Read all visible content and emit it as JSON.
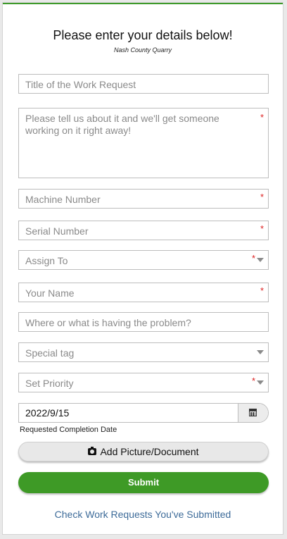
{
  "header": {
    "title": "Please enter your details below!",
    "subtitle": "Nash County Quarry"
  },
  "form": {
    "title_field": {
      "placeholder": "Title of the Work Request",
      "required": false
    },
    "description_field": {
      "placeholder": "Please tell us about it and we'll get someone working on it right away!",
      "required": true
    },
    "machine_number": {
      "placeholder": "Machine Number",
      "required": true
    },
    "serial_number": {
      "placeholder": "Serial Number",
      "required": true
    },
    "assign_to": {
      "placeholder": "Assign To",
      "required": true,
      "type": "dropdown"
    },
    "your_name": {
      "placeholder": "Your Name",
      "required": true
    },
    "location": {
      "placeholder": "Where or what is having the problem?",
      "required": false
    },
    "special_tag": {
      "placeholder": "Special tag",
      "required": false,
      "type": "dropdown"
    },
    "priority": {
      "placeholder": "Set Priority",
      "required": true,
      "type": "dropdown"
    },
    "completion_date": {
      "value": "2022/9/15",
      "label": "Requested Completion Date",
      "icon": "calendar-icon"
    },
    "required_marker": "*"
  },
  "buttons": {
    "add_picture": "Add Picture/Document",
    "add_picture_icon": "camera-icon",
    "submit": "Submit"
  },
  "footer": {
    "link": "Check Work Requests You've Submitted"
  },
  "colors": {
    "accent": "#3e9a26",
    "required": "#dd2222",
    "link": "#3d6b99"
  }
}
